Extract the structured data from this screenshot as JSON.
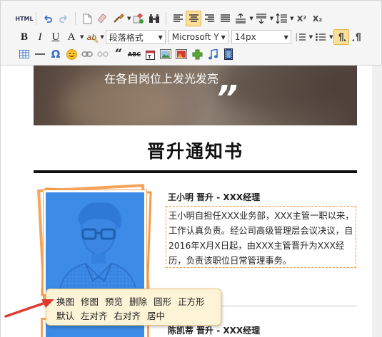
{
  "toolbar": {
    "row1": [
      {
        "name": "html-source-button",
        "label": "HTML"
      },
      {
        "name": "undo-icon"
      },
      {
        "name": "redo-icon"
      },
      {
        "name": "new-document-icon"
      },
      {
        "name": "clear-format-icon"
      },
      {
        "name": "format-painter-icon"
      },
      {
        "name": "auto-typeset-icon"
      },
      {
        "name": "find-replace-icon"
      },
      {
        "name": "align-left-icon"
      },
      {
        "name": "align-center-icon"
      },
      {
        "name": "align-right-icon"
      },
      {
        "name": "align-justify-icon"
      },
      {
        "name": "paragraph-spacing-top-icon"
      },
      {
        "name": "paragraph-spacing-bottom-icon"
      },
      {
        "name": "line-height-icon"
      },
      {
        "name": "superscript-icon",
        "label": "X²"
      },
      {
        "name": "subscript-icon",
        "label": "X₂"
      }
    ],
    "row2": {
      "bold": "B",
      "italic": "I",
      "underline": "U",
      "font_color": "A",
      "highlight": "ab",
      "paragraph_format": "段落格式",
      "font_family": "Microsoft Y",
      "font_size": "14px"
    },
    "row3": [
      {
        "name": "table-icon"
      },
      {
        "name": "horizontal-rule-icon"
      },
      {
        "name": "special-char-icon",
        "label": "Ω"
      },
      {
        "name": "emoticon-icon"
      },
      {
        "name": "link-icon"
      },
      {
        "name": "unlink-icon"
      },
      {
        "name": "quote-icon"
      },
      {
        "name": "strikethrough-icon",
        "label": "ABC"
      },
      {
        "name": "date-icon"
      },
      {
        "name": "image-icon"
      },
      {
        "name": "image-gallery-icon"
      },
      {
        "name": "plugin-icon"
      },
      {
        "name": "music-icon"
      },
      {
        "name": "video-icon"
      }
    ]
  },
  "content": {
    "hero_text": "在各自岗位上发光发亮",
    "hero_quote": "”",
    "title": "晋升通知书",
    "person1": {
      "name": "王小明",
      "position": "晋升 - XXX经理",
      "description": "王小明自担任XXX业务部，XXX主管一职以来，工作认真负责。经公司高级管理层会议决议，自2016年X月X日起，由XXX主管晋升为XXX经历，负责该职位日常管理事务。"
    },
    "person2": {
      "name": "陈凯蒂",
      "position": "晋升 - XXX经理"
    }
  },
  "popup": {
    "row1": [
      "换图",
      "修图",
      "预览",
      "删除",
      "圆形",
      "正方形"
    ],
    "row2": [
      "默认",
      "左对齐",
      "右对齐",
      "居中"
    ]
  },
  "colors": {
    "accent_orange": "#f7a45a",
    "photo_blue": "#3c8be6",
    "popup_bg": "#fdf3d7",
    "arrow_red": "#e03a2e",
    "active_button": "#fcdf9b"
  }
}
